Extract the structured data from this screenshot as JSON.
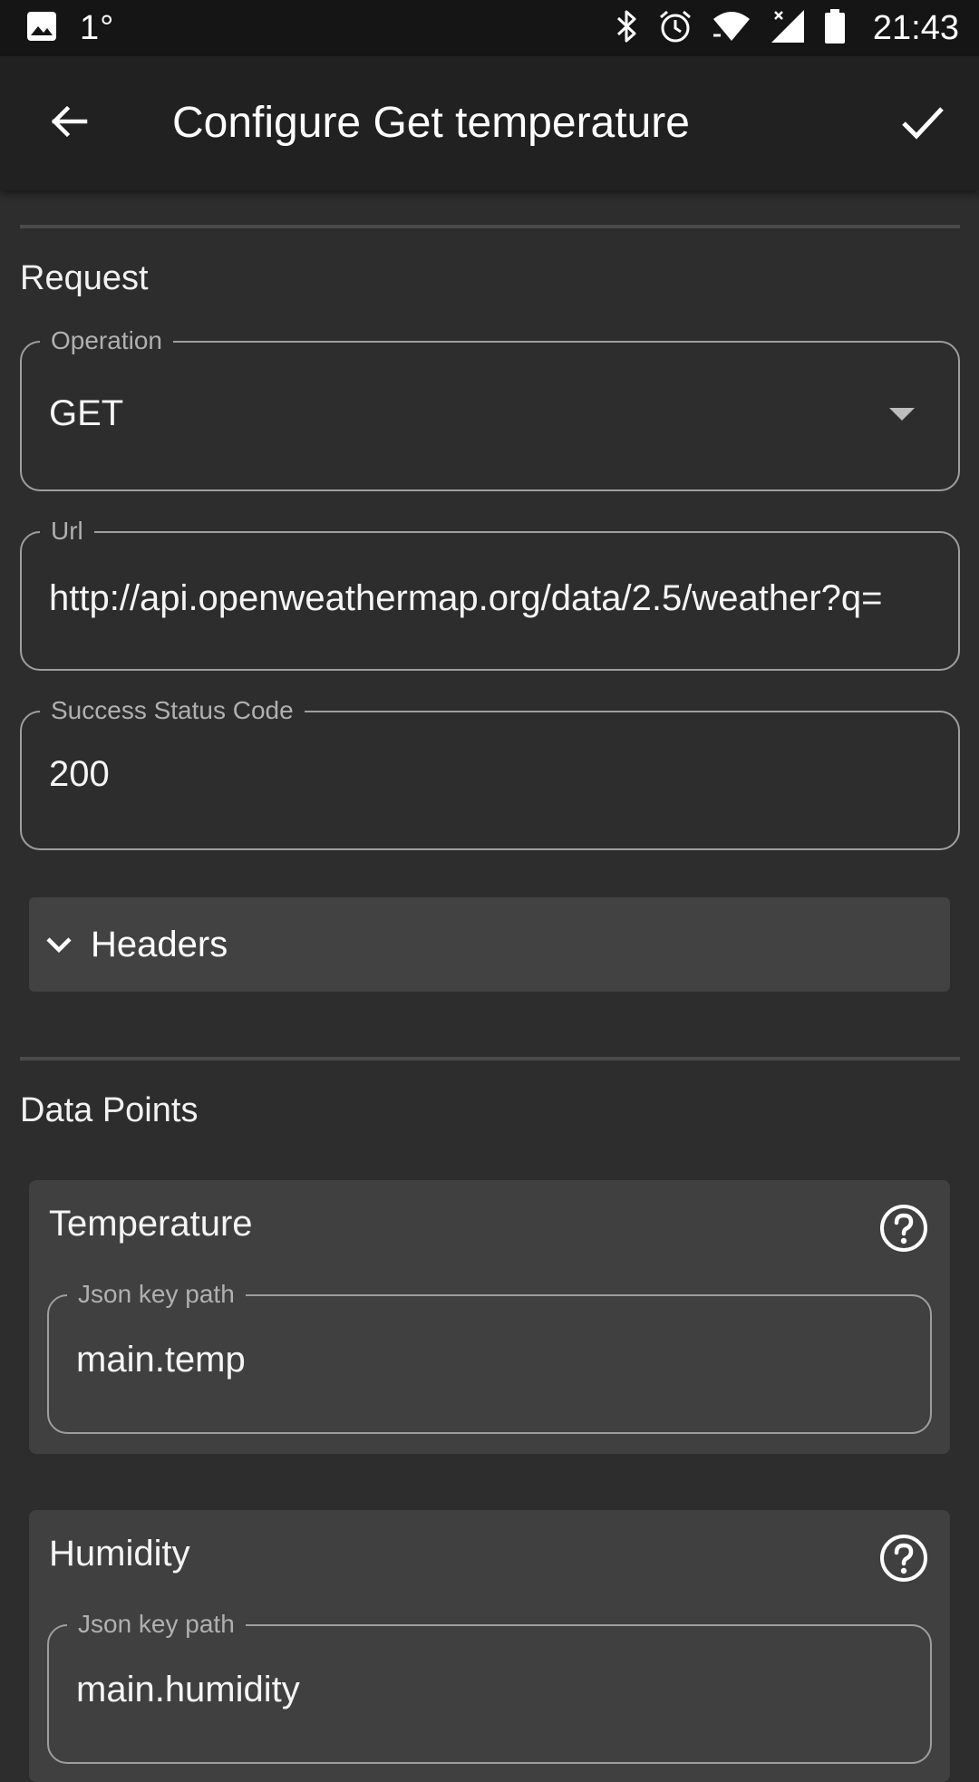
{
  "status_bar": {
    "notification_icon": "image-icon",
    "temperature": "1°",
    "icons": [
      "bluetooth-icon",
      "alarm-icon",
      "wifi-icon",
      "signal-icon",
      "battery-icon"
    ],
    "time": "21:43"
  },
  "app_bar": {
    "back_icon": "arrow-back-icon",
    "title": "Configure Get temperature",
    "save_icon": "check-icon"
  },
  "request": {
    "section_title": "Request",
    "operation": {
      "label": "Operation",
      "value": "GET"
    },
    "url": {
      "label": "Url",
      "value": "http://api.openweathermap.org/data/2.5/weather?q="
    },
    "success_status_code": {
      "label": "Success Status Code",
      "value": "200"
    },
    "headers": {
      "label": "Headers",
      "icon": "chevron-down-icon"
    }
  },
  "data_points": {
    "section_title": "Data Points",
    "items": [
      {
        "title": "Temperature",
        "help_icon": "help-circle-icon",
        "field_label": "Json key path",
        "field_value": "main.temp"
      },
      {
        "title": "Humidity",
        "help_icon": "help-circle-icon",
        "field_label": "Json key path",
        "field_value": "main.humidity"
      }
    ]
  },
  "colors": {
    "background": "#2d2d2d",
    "app_bar": "#212121",
    "status_bar": "#151515",
    "card": "#404040",
    "outline": "#9e9e9e"
  }
}
